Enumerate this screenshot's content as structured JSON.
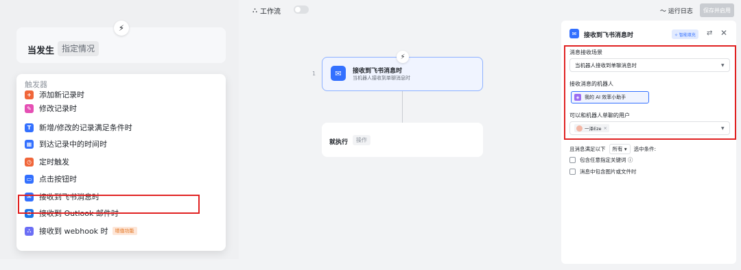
{
  "left": {
    "title": "当发生",
    "tab": "指定情况",
    "menu_header": "触发器",
    "items": [
      {
        "label": "添加新记录时",
        "color": "#f0663a",
        "icon": "plus-square-icon"
      },
      {
        "label": "修改记录时",
        "color": "#e54fb4",
        "icon": "edit-icon"
      },
      {
        "label": "新增/修改的记录满足条件时",
        "color": "#3370ff",
        "icon": "filter-icon"
      },
      {
        "label": "到达记录中的时间时",
        "color": "#3370ff",
        "icon": "calendar-icon"
      },
      {
        "label": "定时触发",
        "color": "#f0663a",
        "icon": "clock-icon"
      },
      {
        "label": "点击按钮时",
        "color": "#3370ff",
        "icon": "button-icon"
      },
      {
        "label": "接收到飞书消息时",
        "color": "#3370ff",
        "icon": "feishu-icon"
      },
      {
        "label": "接收到 Outlook 邮件时",
        "color": "#1a73e8",
        "icon": "outlook-icon"
      },
      {
        "label": "接收到 webhook 时",
        "color": "#6b6ef5",
        "icon": "webhook-icon",
        "badge": "增值功能"
      }
    ]
  },
  "topbar": {
    "flow_label": "工作流",
    "logs_label": "运行日志",
    "save_label": "保存并启用"
  },
  "canvas": {
    "node1": {
      "index": "1",
      "title": "接收到飞书消息时",
      "subtitle": "当机器人接收到单聊消息时"
    },
    "node2": {
      "title": "就执行",
      "tag": "操作"
    }
  },
  "panel": {
    "title": "接收到飞书消息时",
    "smart_fill": "✧ 智能填充",
    "scene_label": "消息接收场景",
    "scene_value": "当机器人接收到单聊消息时",
    "bot_label": "接收消息的机器人",
    "bot_value": "我的 AI 效率小助手",
    "users_label": "可以和机器人单聊的用户",
    "user_tag": "一泽Eze",
    "cond_prefix": "且消息满足以下",
    "cond_select": "所有",
    "cond_suffix": "选中条件:",
    "cb1": "包含任意指定关键词 ⓘ",
    "cb2": "消息中包含图片或文件时"
  }
}
